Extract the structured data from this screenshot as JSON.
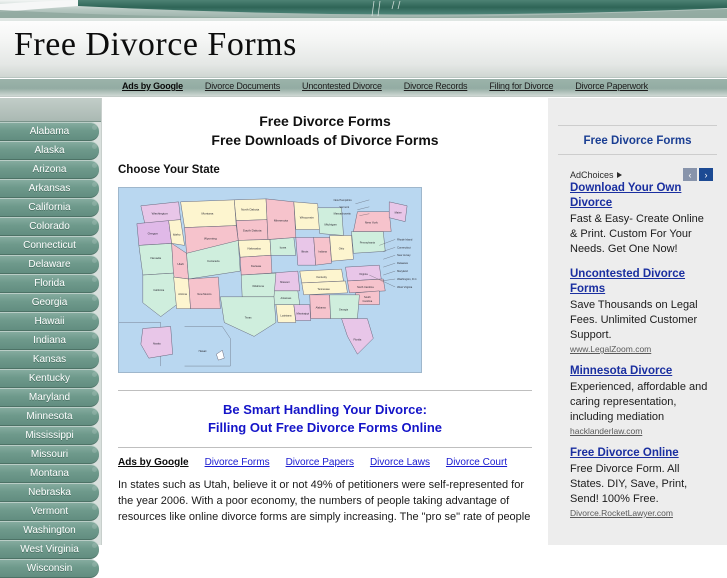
{
  "site": {
    "title": "Free Divorce Forms"
  },
  "top_nav": {
    "ads_label": "Ads by Google",
    "links": [
      "Divorce Documents",
      "Uncontested Divorce",
      "Divorce Records",
      "Filing for Divorce",
      "Divorce Paperwork"
    ]
  },
  "sidebar": {
    "states": [
      "Alabama",
      "Alaska",
      "Arizona",
      "Arkansas",
      "California",
      "Colorado",
      "Connecticut",
      "Delaware",
      "Florida",
      "Georgia",
      "Hawaii",
      "Indiana",
      "Kansas",
      "Kentucky",
      "Maryland",
      "Minnesota",
      "Mississippi",
      "Missouri",
      "Montana",
      "Nebraska",
      "Vermont",
      "Washington",
      "West Virginia",
      "Wisconsin"
    ]
  },
  "main": {
    "heading_1": "Free Divorce Forms",
    "heading_2": "Free Downloads of Divorce Forms",
    "choose_state_label": "Choose Your State",
    "map_alt": "us-state-map",
    "article_heading_1": "Be Smart Handling Your Divorce:",
    "article_heading_2": "Filling Out Free Divorce Forms Online",
    "inline_ads_label": "Ads by Google",
    "inline_ads_links": [
      "Divorce Forms",
      "Divorce Papers",
      "Divorce Laws",
      "Divorce Court"
    ],
    "article_body": "In states such as Utah, believe it or not 49% of petitioners were self-represented for the year 2006. With a poor economy, the numbers of people taking advantage of resources like online divorce forms are simply increasing. The \"pro se\" rate of people"
  },
  "ad_rail": {
    "title": "Free Divorce Forms",
    "adchoices_label": "AdChoices",
    "arrow_prev": "‹",
    "arrow_next": "›",
    "ads": [
      {
        "title": "Download Your Own Divorce",
        "desc": "Fast & Easy- Create Online & Print. Custom For Your Needs. Get One Now!",
        "url": ""
      },
      {
        "title": "Uncontested Divorce Forms",
        "desc": "Save Thousands on Legal Fees. Unlimited Customer Support.",
        "url": "www.LegalZoom.com"
      },
      {
        "title": "Minnesota Divorce",
        "desc": "Experienced, affordable and caring representation, including mediation",
        "url": "hacklanderlaw.com"
      },
      {
        "title": "Free Divorce Online",
        "desc": "Free Divorce Form. All States. DIY, Save, Print, Send! 100% Free.",
        "url": "Divorce.RocketLawyer.com"
      }
    ]
  },
  "map": {
    "ocean_color": "#b9d7f0",
    "labels": [
      "Washington",
      "Montana",
      "North Dakota",
      "Minnesota",
      "Maine",
      "Oregon",
      "Idaho",
      "South Dakota",
      "Wisconsin",
      "Michigan",
      "New York",
      "Vermont",
      "New Hampshire",
      "Massachusetts",
      "Wyoming",
      "Iowa",
      "Nebraska",
      "Illinois",
      "Indiana",
      "Ohio",
      "Pennsylvania",
      "Nevada",
      "Utah",
      "Colorado",
      "Kansas",
      "Missouri",
      "Kentucky",
      "Virginia",
      "West Virginia",
      "California",
      "Arizona",
      "New Mexico",
      "Oklahoma",
      "Arkansas",
      "Tennessee",
      "North Carolina",
      "South Carolina",
      "Texas",
      "Louisiana",
      "Mississippi",
      "Alabama",
      "Georgia",
      "Florida",
      "Alaska",
      "Hawaii",
      "Rhode Island",
      "Connecticut",
      "New Jersey",
      "Delaware",
      "Maryland",
      "Washington, D.C."
    ]
  },
  "colors": {
    "sidebar_green": "#6f9a8c",
    "banner_green": "#3e7365",
    "ad_link_blue": "#1a2fa0",
    "heading_blue": "#1414c8",
    "rail_bg": "#ededed"
  }
}
